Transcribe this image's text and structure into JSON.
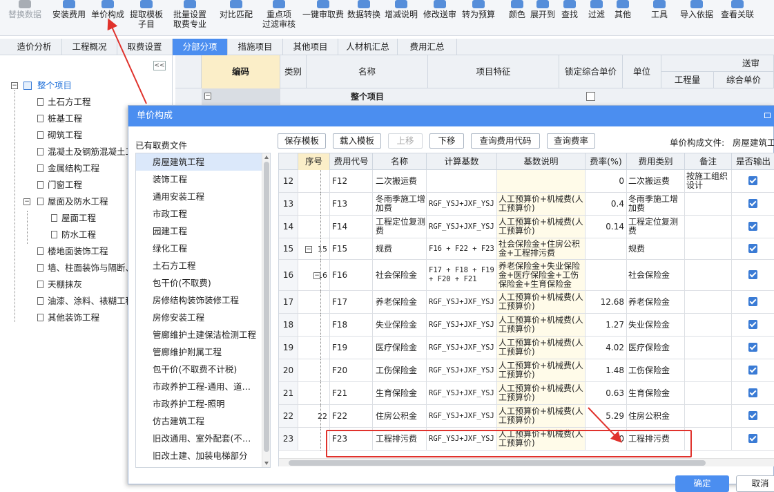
{
  "toolbar": {
    "buttons": [
      {
        "label": "替换数据",
        "label2": ""
      },
      {
        "label": "安装费用",
        "label2": ""
      },
      {
        "label": "单价构成",
        "label2": ""
      },
      {
        "label": "提取模板",
        "label2": "子目"
      },
      {
        "label": "批量设置",
        "label2": "取费专业"
      },
      {
        "label": "对比匹配",
        "label2": ""
      },
      {
        "label": "重点项",
        "label2": "过滤审核"
      },
      {
        "label": "一键审取费",
        "label2": ""
      },
      {
        "label": "数据转换",
        "label2": ""
      },
      {
        "label": "增减说明",
        "label2": ""
      },
      {
        "label": "修改送审",
        "label2": ""
      },
      {
        "label": "转为预算",
        "label2": ""
      },
      {
        "label": "颜色",
        "label2": ""
      },
      {
        "label": "展开到",
        "label2": ""
      },
      {
        "label": "查找",
        "label2": ""
      },
      {
        "label": "过滤",
        "label2": ""
      },
      {
        "label": "其他",
        "label2": ""
      },
      {
        "label": "工具",
        "label2": ""
      },
      {
        "label": "导入依据",
        "label2": ""
      },
      {
        "label": "查看关联",
        "label2": ""
      }
    ]
  },
  "tabs": [
    "造价分析",
    "工程概况",
    "取费设置",
    "分部分项",
    "措施项目",
    "其他项目",
    "人材机汇总",
    "费用汇总"
  ],
  "tree": {
    "collapse_label": "<<",
    "root": "整个项目",
    "items": [
      "土石方工程",
      "桩基工程",
      "砌筑工程",
      "混凝土及钢筋混凝土工",
      "金属结构工程",
      "门窗工程",
      "屋面及防水工程",
      "屋面工程",
      "防水工程",
      "楼地面装饰工程",
      "墙、柱面装饰与隔断、",
      "天棚抹灰",
      "油漆、涂料、裱糊工程",
      "其他装饰工程"
    ]
  },
  "background_grid": {
    "headers": [
      "编码",
      "类别",
      "名称",
      "项目特征",
      "锁定综合单价",
      "单位"
    ],
    "group_header": "送审",
    "sub_headers": [
      "工程量",
      "综合单价"
    ],
    "row1_label": "整个项目"
  },
  "dialog": {
    "title": "单价构成",
    "file_list_label": "已有取费文件",
    "file_label": "单价构成文件:",
    "file_value": "房屋建筑工",
    "buttons": [
      "保存模板",
      "载入模板",
      "上移",
      "下移",
      "查询费用代码",
      "查询费率"
    ],
    "file_list": [
      "房屋建筑工程",
      "装饰工程",
      "通用安装工程",
      "市政工程",
      "园建工程",
      "绿化工程",
      "土石方工程",
      "包干价(不取费)",
      "房修结构装饰装修工程",
      "房修安装工程",
      "管廊维护土建保洁检测工程",
      "管廊维护附属工程",
      "包干价(不取费不计税)",
      "市政养护工程-通用、道…",
      "市政养护工程-照明",
      "仿古建筑工程",
      "旧改通用、室外配套(不…",
      "旧改土建、加装电梯部分"
    ],
    "grid_headers": [
      "序号",
      "费用代号",
      "名称",
      "计算基数",
      "基数说明",
      "费率(%)",
      "费用类别",
      "备注",
      "是否输出"
    ],
    "rows": [
      {
        "idx": "12",
        "seq": "",
        "code": "F12",
        "name": "二次搬运费",
        "formula": "",
        "desc": "",
        "rate": "0",
        "cat": "二次搬运费",
        "note": "按施工组织设计",
        "checked": true
      },
      {
        "idx": "13",
        "seq": "",
        "code": "F13",
        "name": "冬雨季施工增加费",
        "formula": "RGF_YSJ+JXF_YSJ",
        "desc": "人工预算价+机械费(人工预算价)",
        "rate": "0.4",
        "cat": "冬雨季施工增加费",
        "note": "",
        "checked": true
      },
      {
        "idx": "14",
        "seq": "",
        "code": "F14",
        "name": "工程定位复测费",
        "formula": "RGF_YSJ+JXF_YSJ",
        "desc": "人工预算价+机械费(人工预算价)",
        "rate": "0.14",
        "cat": "工程定位复测费",
        "note": "",
        "checked": true
      },
      {
        "idx": "15",
        "seq": "15",
        "code": "F15",
        "name": "规费",
        "formula": "F16 + F22 + F23",
        "desc": "社会保险金+住房公积金+工程排污费",
        "rate": "",
        "cat": "规费",
        "note": "",
        "checked": true
      },
      {
        "idx": "16",
        "seq": "16",
        "code": "F16",
        "name": "社会保险金",
        "formula": "F17 + F18 + F19 + F20 + F21",
        "desc": "养老保险金+失业保险金+医疗保险金+工伤保险金+生育保险金",
        "rate": "",
        "cat": "社会保险金",
        "note": "",
        "checked": true
      },
      {
        "idx": "17",
        "seq": "",
        "code": "F17",
        "name": "养老保险金",
        "formula": "RGF_YSJ+JXF_YSJ",
        "desc": "人工预算价+机械费(人工预算价)",
        "rate": "12.68",
        "cat": "养老保险金",
        "note": "",
        "checked": true
      },
      {
        "idx": "18",
        "seq": "",
        "code": "F18",
        "name": "失业保险金",
        "formula": "RGF_YSJ+JXF_YSJ",
        "desc": "人工预算价+机械费(人工预算价)",
        "rate": "1.27",
        "cat": "失业保险金",
        "note": "",
        "checked": true
      },
      {
        "idx": "19",
        "seq": "",
        "code": "F19",
        "name": "医疗保险金",
        "formula": "RGF_YSJ+JXF_YSJ",
        "desc": "人工预算价+机械费(人工预算价)",
        "rate": "4.02",
        "cat": "医疗保险金",
        "note": "",
        "checked": true
      },
      {
        "idx": "20",
        "seq": "",
        "code": "F20",
        "name": "工伤保险金",
        "formula": "RGF_YSJ+JXF_YSJ",
        "desc": "人工预算价+机械费(人工预算价)",
        "rate": "1.48",
        "cat": "工伤保险金",
        "note": "",
        "checked": true
      },
      {
        "idx": "21",
        "seq": "",
        "code": "F21",
        "name": "生育保险金",
        "formula": "RGF_YSJ+JXF_YSJ",
        "desc": "人工预算价+机械费(人工预算价)",
        "rate": "0.63",
        "cat": "生育保险金",
        "note": "",
        "checked": true
      },
      {
        "idx": "22",
        "seq": "22",
        "code": "F22",
        "name": "住房公积金",
        "formula": "RGF_YSJ+JXF_YSJ",
        "desc": "人工预算价+机械费(人工预算价)",
        "rate": "5.29",
        "cat": "住房公积金",
        "note": "",
        "checked": true
      },
      {
        "idx": "23",
        "seq": "",
        "code": "F23",
        "name": "工程排污费",
        "formula": "RGF_YSJ+JXF_YSJ",
        "desc": "人工预算价+机械费(人工预算价)",
        "rate": "0",
        "cat": "工程排污费",
        "note": "",
        "checked": true
      }
    ],
    "ok_label": "确定",
    "cancel_label": "取消"
  },
  "colors": {
    "accent": "#4b8ef0",
    "annotation": "#e0322c",
    "highlight_col": "#fbeec8"
  }
}
